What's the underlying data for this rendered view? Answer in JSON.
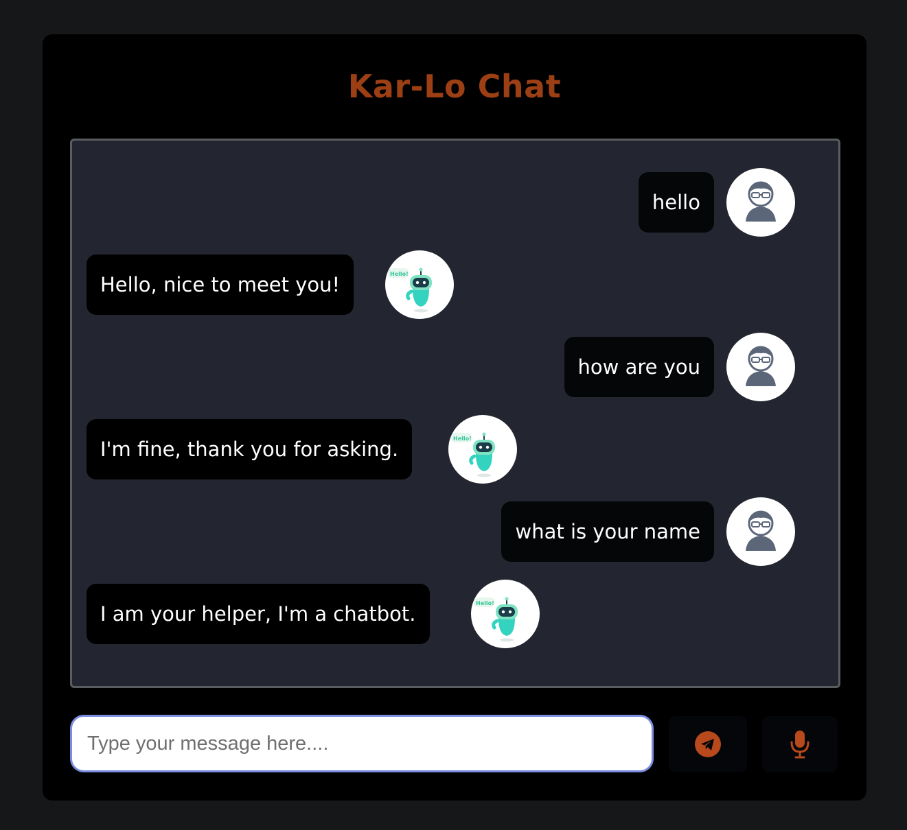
{
  "app": {
    "title": "Kar-Lo Chat",
    "accent_color": "#9c3f14"
  },
  "messages": [
    {
      "sender": "user",
      "text": "hello",
      "avatar_icon": "user-avatar-icon"
    },
    {
      "sender": "bot",
      "text": "Hello, nice to meet you!",
      "avatar_icon": "robot-avatar-icon",
      "avatar_text": "Hello!"
    },
    {
      "sender": "user",
      "text": "how are you",
      "avatar_icon": "user-avatar-icon"
    },
    {
      "sender": "bot",
      "text": "I'm fine, thank you for asking.",
      "avatar_icon": "robot-avatar-icon",
      "avatar_text": "Hello!"
    },
    {
      "sender": "user",
      "text": "what is your name",
      "avatar_icon": "user-avatar-icon"
    },
    {
      "sender": "bot",
      "text": "I am your helper, I'm a chatbot.",
      "avatar_icon": "robot-avatar-icon",
      "avatar_text": "Hello!"
    }
  ],
  "composer": {
    "placeholder": "Type your message here....",
    "value": "",
    "send_icon": "send-icon",
    "mic_icon": "microphone-icon"
  }
}
